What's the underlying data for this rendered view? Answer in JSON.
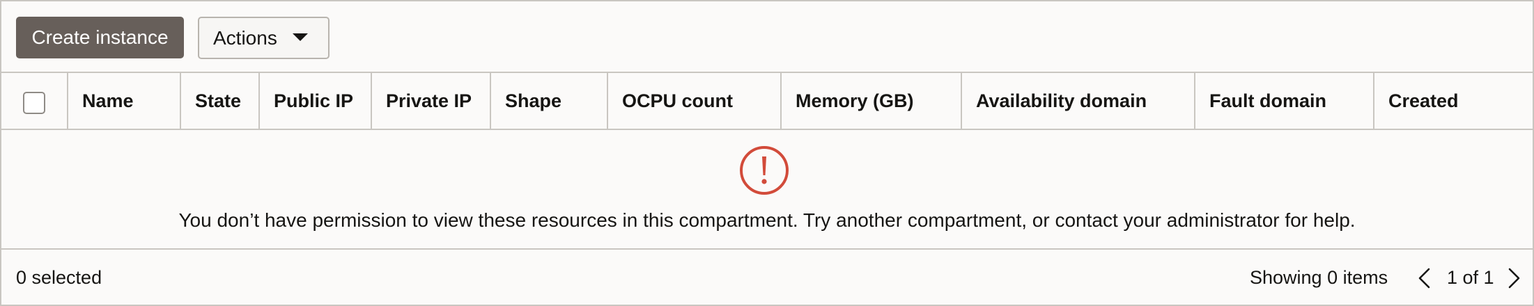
{
  "toolbar": {
    "create_label": "Create instance",
    "actions_label": "Actions"
  },
  "table": {
    "columns": [
      "Name",
      "State",
      "Public IP",
      "Private IP",
      "Shape",
      "OCPU count",
      "Memory (GB)",
      "Availability domain",
      "Fault domain",
      "Created"
    ],
    "empty_message": "You don’t have permission to view these resources in this compartment. Try another compartment, or contact your administrator for help."
  },
  "footer": {
    "selected": "0 selected",
    "showing": "Showing 0 items",
    "page": "1 of 1"
  },
  "icons": {
    "alert": "exclamation-circle-icon",
    "caret": "caret-down-icon",
    "prev": "chevron-left-icon",
    "next": "chevron-right-icon"
  },
  "colors": {
    "primary_button": "#675f5a",
    "alert": "#d24b3a",
    "border": "#c9c6c1",
    "background": "#fbfaf9"
  }
}
